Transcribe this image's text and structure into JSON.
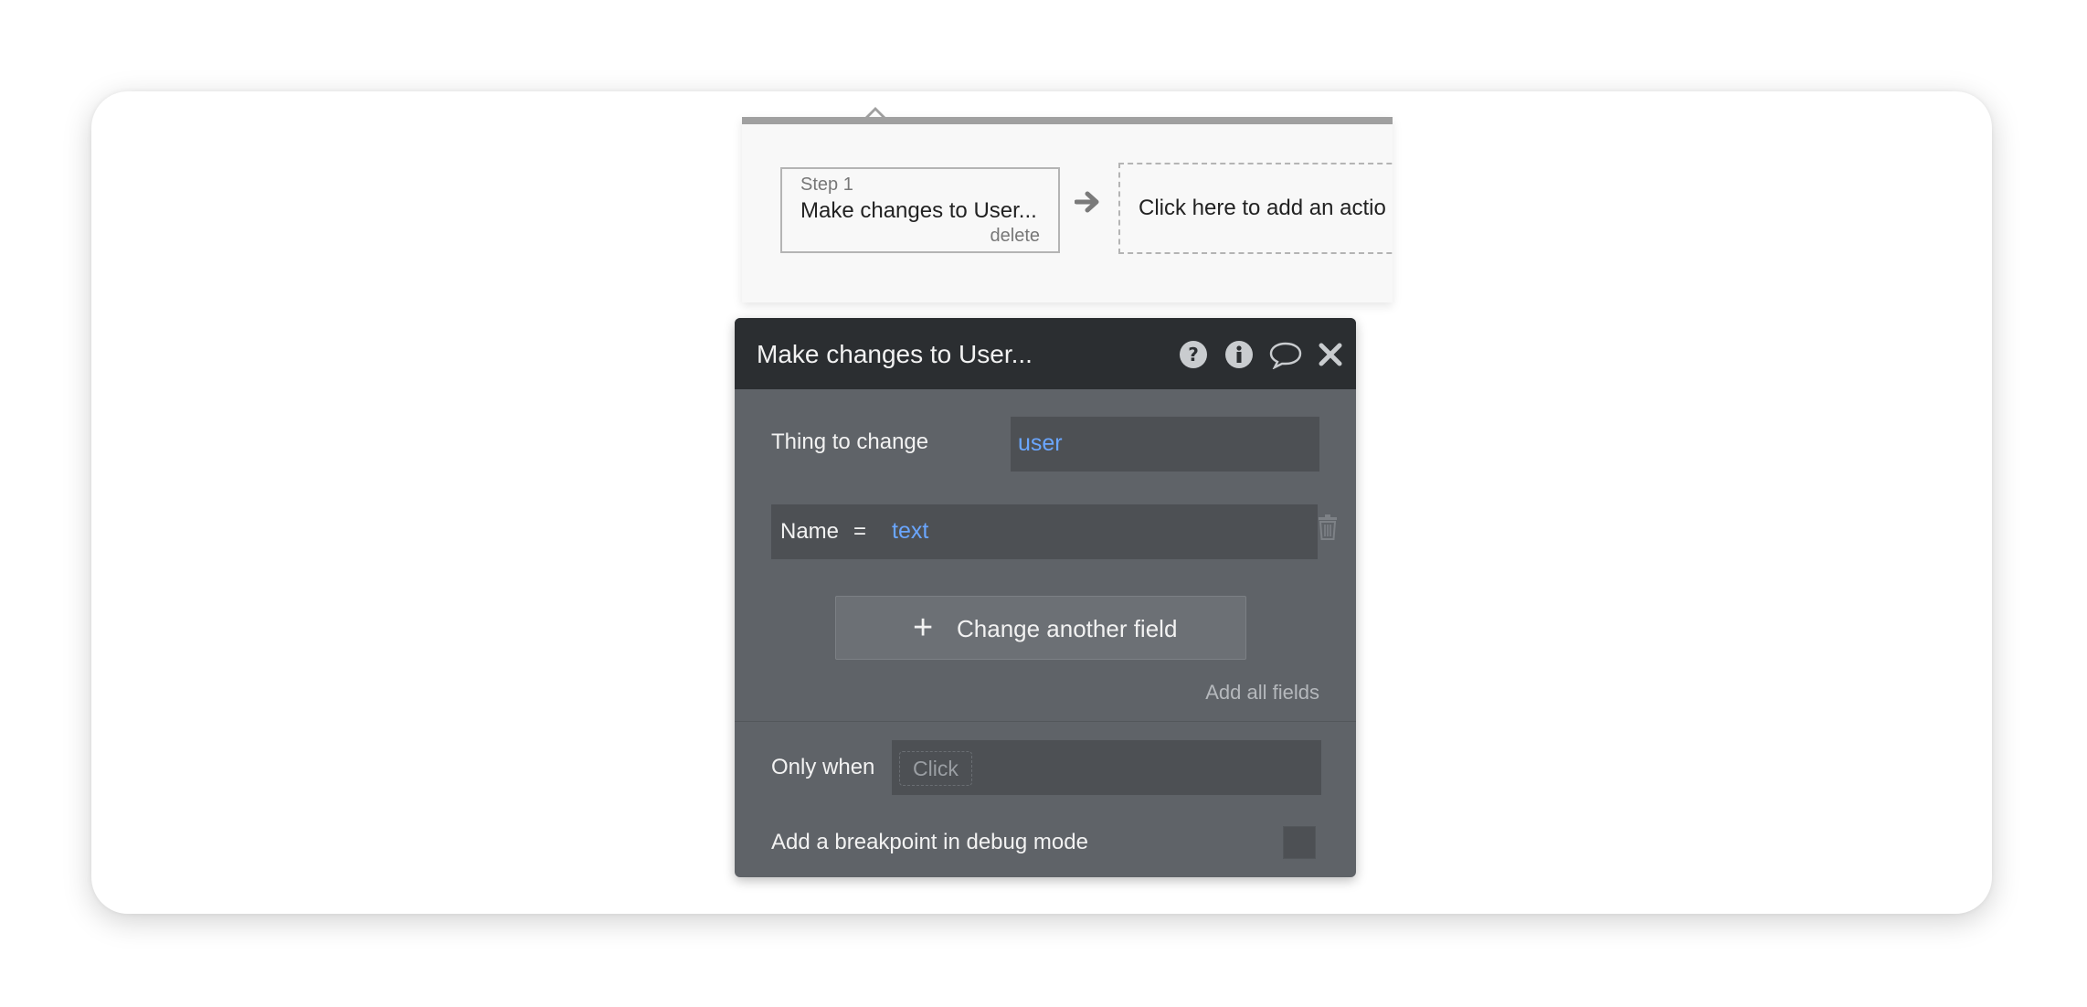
{
  "workflow": {
    "step": {
      "label": "Step 1",
      "title": "Make changes to User...",
      "delete_label": "delete"
    },
    "add_action_label": "Click here to add an actio"
  },
  "panel": {
    "title": "Make changes to User...",
    "icons": [
      "question-icon",
      "info-icon",
      "comment-icon",
      "close-icon"
    ],
    "thing_to_change": {
      "label": "Thing to change",
      "value": "user"
    },
    "field_change": {
      "field": "Name",
      "operator": "=",
      "value": "text"
    },
    "change_another_label": "Change another field",
    "add_all_label": "Add all fields",
    "only_when": {
      "label": "Only when",
      "placeholder": "Click"
    },
    "breakpoint_label": "Add a breakpoint in debug mode",
    "breakpoint_checked": false
  },
  "colors": {
    "header": "#2b2e31",
    "panel": "#5f6368",
    "field": "#4d5054",
    "dynamic_value": "#6aa6ff"
  }
}
